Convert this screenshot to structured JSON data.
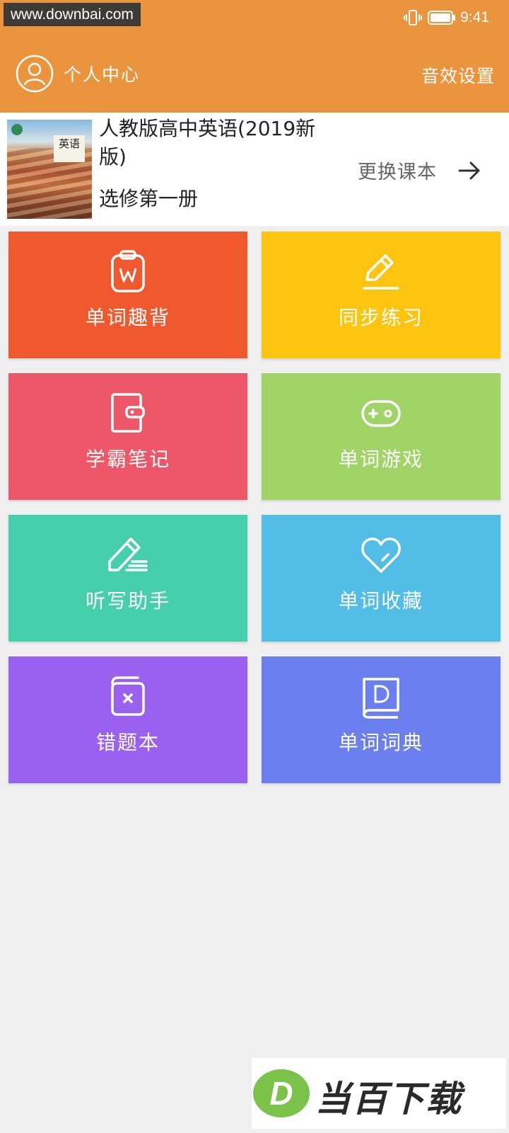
{
  "status_bar": {
    "watermark": "www.downbai.com",
    "time": "9:41"
  },
  "header": {
    "personal_label": "个人中心",
    "sound_settings": "音效设置"
  },
  "book": {
    "title": "人教版高中英语(2019新版)",
    "volume": "选修第一册",
    "cover_title": "英语",
    "change_label": "更换课本"
  },
  "tiles": [
    {
      "label": "单词趣背",
      "icon": "clipboard-w-icon",
      "color": "#f0582d"
    },
    {
      "label": "同步练习",
      "icon": "pencil-icon",
      "color": "#fdc50f"
    },
    {
      "label": "学霸笔记",
      "icon": "notebook-icon",
      "color": "#ed5767"
    },
    {
      "label": "单词游戏",
      "icon": "gamepad-icon",
      "color": "#a1d466"
    },
    {
      "label": "听写助手",
      "icon": "eraser-write-icon",
      "color": "#45cfad"
    },
    {
      "label": "单词收藏",
      "icon": "heart-icon",
      "color": "#52bde6"
    },
    {
      "label": "错题本",
      "icon": "error-book-icon",
      "color": "#9a61f1"
    },
    {
      "label": "单词词典",
      "icon": "dictionary-icon",
      "color": "#6a7eee"
    }
  ],
  "watermark_bottom": {
    "logo_letter": "D",
    "text": "当百下载"
  }
}
